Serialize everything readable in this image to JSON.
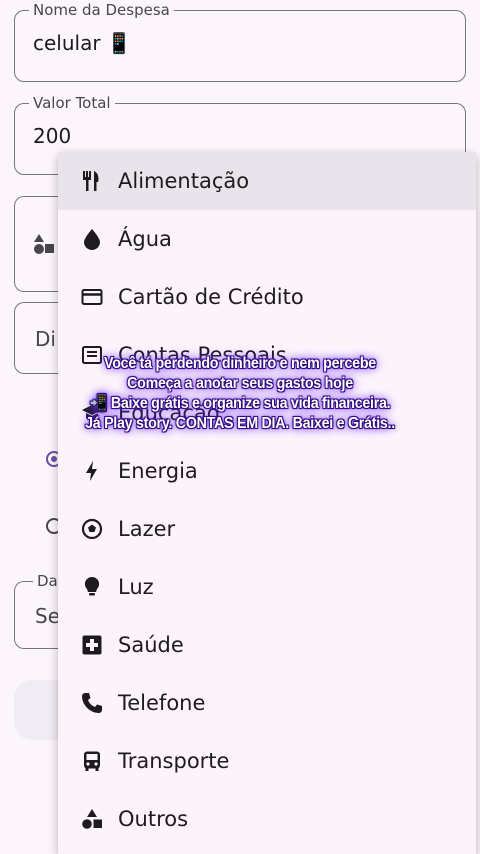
{
  "form": {
    "name_field": {
      "label": "Nome da Despesa",
      "value": "celular 📱"
    },
    "total_field": {
      "label": "Valor Total",
      "value": "200"
    },
    "payment_stub": "Di",
    "date_field": {
      "label": "Da",
      "value": "Se"
    }
  },
  "category_menu": {
    "items": [
      {
        "label": "Alimentação",
        "icon": "fork-knife-icon"
      },
      {
        "label": "Água",
        "icon": "water-drop-icon"
      },
      {
        "label": "Cartão de Crédito",
        "icon": "credit-card-icon"
      },
      {
        "label": "Contas Pessoais",
        "icon": "bill-icon"
      },
      {
        "label": "Educação",
        "icon": "school-icon"
      },
      {
        "label": "Energia",
        "icon": "bolt-icon"
      },
      {
        "label": "Lazer",
        "icon": "soccer-ball-icon"
      },
      {
        "label": "Luz",
        "icon": "lightbulb-icon"
      },
      {
        "label": "Saúde",
        "icon": "medical-cross-icon"
      },
      {
        "label": "Telefone",
        "icon": "phone-icon"
      },
      {
        "label": "Transporte",
        "icon": "bus-icon"
      },
      {
        "label": "Outros",
        "icon": "shapes-icon"
      }
    ]
  },
  "overlay_caption": {
    "line1": "Você tá perdendo dinheiro e nem percebe",
    "line2": "Começa a anotar seus gastos hoje",
    "line3": "📲 Baixe grátis e organize sua vida financeira.",
    "line4": "Já Play story. CONTAS EM DIA. Baixei e Grátis.."
  },
  "colors": {
    "accent": "#6750a4",
    "menu_bg": "#fdf4fb",
    "caption_glow": "#7b3cff"
  }
}
